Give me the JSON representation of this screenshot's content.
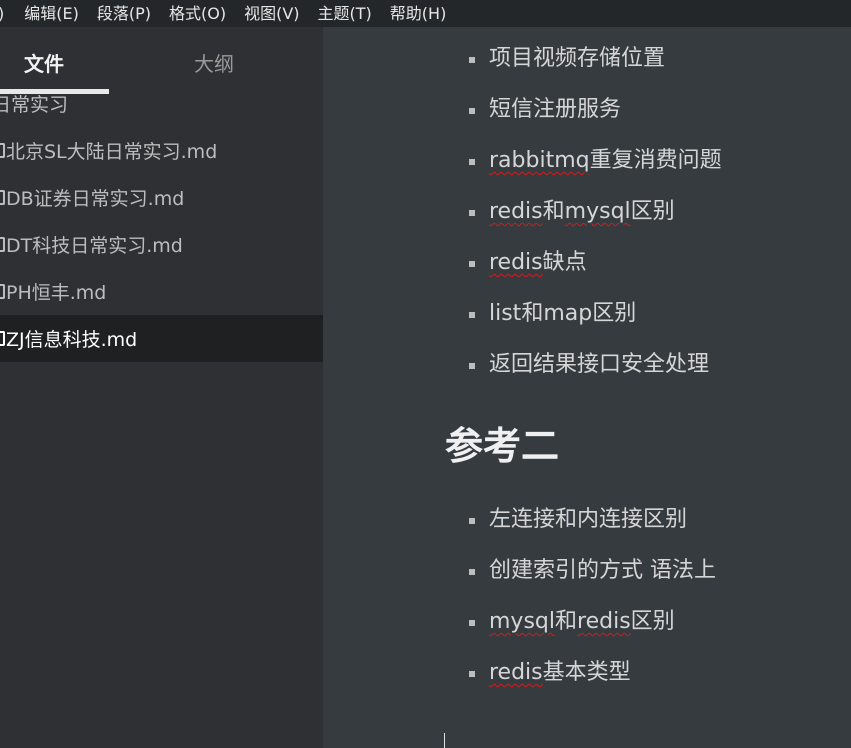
{
  "menubar": {
    "items": [
      ")",
      "编辑(E)",
      "段落(P)",
      "格式(O)",
      "视图(V)",
      "主题(T)",
      "帮助(H)"
    ]
  },
  "sidebar": {
    "tabs": {
      "files": "文件",
      "outline": "大纲"
    },
    "folder": "日常实习",
    "files": [
      "北京SL大陆日常实习.md",
      "DB证券日常实习.md",
      "DT科技日常实习.md",
      "PH恒丰.md",
      "ZJ信息科技.md"
    ],
    "active_file": "ZJ信息科技.md"
  },
  "editor": {
    "list1": [
      [
        "项目视频存储位置"
      ],
      [
        "短信注册服务"
      ],
      [
        "rabbitmq",
        "重复消费问题"
      ],
      [
        "redis",
        "和",
        "mysql",
        "区别"
      ],
      [
        "redis",
        "缺点"
      ],
      [
        "list和map区别"
      ],
      [
        "返回结果接口安全处理"
      ]
    ],
    "heading": "参考二",
    "list2": [
      [
        "左连接和内连接区别"
      ],
      [
        "创建索引的方式 语法上"
      ],
      [
        "mysql",
        "和",
        "redis",
        "区别"
      ],
      [
        "redis",
        "基本类型"
      ]
    ]
  },
  "colors": {
    "menubar_bg": "#242729",
    "sidebar_bg": "#2e3033",
    "active_row_bg": "#1f2022",
    "editor_bg": "#363b40",
    "spellcheck": "#d11c1c"
  }
}
